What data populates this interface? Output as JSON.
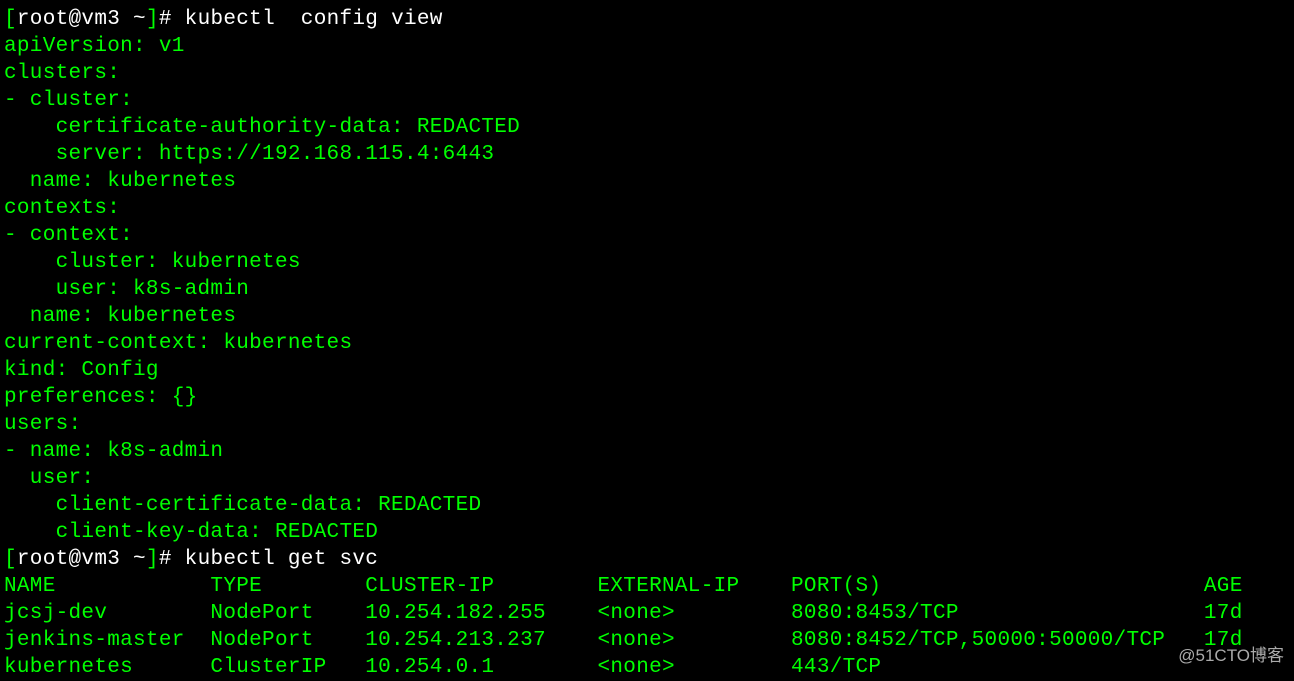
{
  "prompts": [
    {
      "user": "root",
      "host": "vm3",
      "cwd": "~",
      "hash": "#",
      "command": "kubectl  config view"
    },
    {
      "user": "root",
      "host": "vm3",
      "cwd": "~",
      "hash": "#",
      "command": "kubectl get svc"
    }
  ],
  "config_output": {
    "apiVersion": "apiVersion: v1",
    "clusters_hdr": "clusters:",
    "cluster_item": "- cluster:",
    "cert_auth": "    certificate-authority-data: REDACTED",
    "server": "    server: https://192.168.115.4:6443",
    "cluster_name": "  name: kubernetes",
    "contexts_hdr": "contexts:",
    "context_item": "- context:",
    "ctx_cluster": "    cluster: kubernetes",
    "ctx_user": "    user: k8s-admin",
    "ctx_name": "  name: kubernetes",
    "current_ctx": "current-context: kubernetes",
    "kind": "kind: Config",
    "preferences": "preferences: {}",
    "users_hdr": "users:",
    "user_name": "- name: k8s-admin",
    "user_item": "  user:",
    "client_cert": "    client-certificate-data: REDACTED",
    "client_key": "    client-key-data: REDACTED"
  },
  "svc_table": {
    "header": {
      "name": "NAME",
      "type": "TYPE",
      "cluster_ip": "CLUSTER-IP",
      "external_ip": "EXTERNAL-IP",
      "ports": "PORT(S)",
      "age": "AGE"
    },
    "rows": [
      {
        "name": "jcsj-dev",
        "type": "NodePort",
        "cluster_ip": "10.254.182.255",
        "external_ip": "<none>",
        "ports": "8080:8453/TCP",
        "age": "17d"
      },
      {
        "name": "jenkins-master",
        "type": "NodePort",
        "cluster_ip": "10.254.213.237",
        "external_ip": "<none>",
        "ports": "8080:8452/TCP,50000:50000/TCP",
        "age": "17d"
      },
      {
        "name": "kubernetes",
        "type": "ClusterIP",
        "cluster_ip": "10.254.0.1",
        "external_ip": "<none>",
        "ports": "443/TCP",
        "age": ""
      }
    ]
  },
  "watermark": "@51CTO博客"
}
